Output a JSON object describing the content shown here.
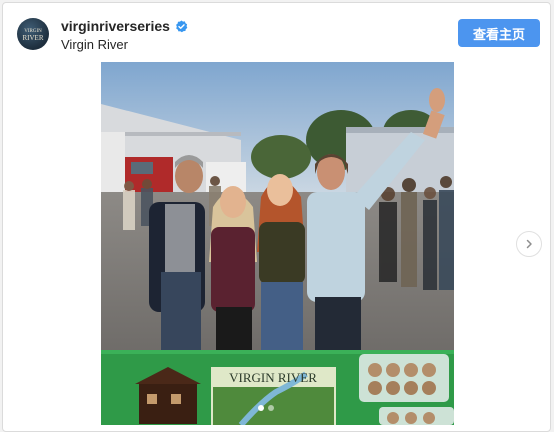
{
  "header": {
    "username": "virginriverseries",
    "subtitle": "Virgin River",
    "view_profile_label": "查看主页",
    "avatar_text": "VIRGIN RIVER"
  },
  "media": {
    "book_cover_title": "VIRGIN RIVER",
    "carousel_dots": 2,
    "active_dot": 1
  },
  "colors": {
    "button": "#4c95ef",
    "verified": "#3897f0",
    "tablecloth": "#2f9a48"
  },
  "icons": [
    "verified-badge-icon",
    "chevron-right-icon"
  ]
}
